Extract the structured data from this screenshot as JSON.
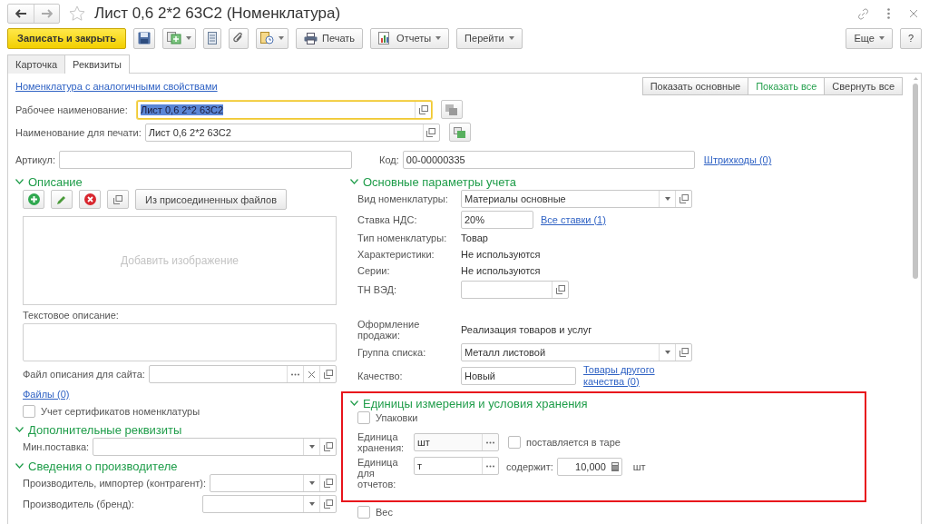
{
  "window": {
    "title": "Лист 0,6 2*2 63С2 (Номенклатура)",
    "favorite": false
  },
  "toolbar": {
    "items": [
      {
        "kind": "primary",
        "label": "Записать и закрыть"
      },
      {
        "kind": "icon"
      },
      {
        "kind": "icon-menu"
      },
      {
        "kind": "icon"
      },
      {
        "kind": "icon"
      },
      {
        "kind": "icon-menu"
      },
      {
        "kind": "text",
        "label": "Печать"
      },
      {
        "kind": "text-menu",
        "label": "Отчеты"
      },
      {
        "kind": "text-menu",
        "label": "Перейти"
      }
    ],
    "right": [
      {
        "kind": "text-menu",
        "label": "Еще"
      },
      {
        "kind": "text",
        "label": "?"
      }
    ]
  },
  "tabs": [
    {
      "label": "Карточка",
      "selected": false
    },
    {
      "label": "Реквизиты",
      "selected": true
    }
  ],
  "similar_link": "Номенклатура с аналогичными свойствами",
  "view_buttons": [
    {
      "label": "Показать основные",
      "selected": false
    },
    {
      "label": "Показать все",
      "selected": true
    },
    {
      "label": "Свернуть все",
      "selected": false
    }
  ],
  "names": [
    {
      "label": "Рабочее наименование:",
      "value": "Лист 0,6 2*2 63С2",
      "focused": true
    },
    {
      "label": "Наименование для печати:",
      "value": "Лист 0,6 2*2 63С2",
      "focused": false
    }
  ],
  "article": {
    "label": "Артикул:"
  },
  "code": {
    "label": "Код:",
    "value": "00-00000335"
  },
  "barcodes_link": "Штрихкоды (0)",
  "description": {
    "title": "Описание",
    "expanded": true,
    "attach_button": "Из присоединенных файлов",
    "image_placeholder": "Добавить изображение",
    "text_label": "Текстовое описание:",
    "site_file_label": "Файл описания для сайта:",
    "files_link": "Файлы (0)",
    "certificates": {
      "label": "Учет сертификатов номенклатуры",
      "checked": false
    }
  },
  "extra": {
    "title": "Дополнительные реквизиты",
    "expanded": true,
    "min_supply_label": "Мин.поставка:"
  },
  "manufacturer": {
    "title": "Сведения о производителе",
    "expanded": true,
    "fields": [
      {
        "label": "Производитель, импортер (контрагент):"
      },
      {
        "label": "Производитель (бренд):"
      }
    ]
  },
  "accounting": {
    "title": "Основные параметры учета",
    "expanded": true,
    "rows": [
      {
        "kind": "select",
        "label": "Вид номенклатуры:",
        "value": "Материалы основные"
      },
      {
        "kind": "input-link",
        "label": "Ставка НДС:",
        "value": "20%",
        "link": "Все ставки (1)"
      },
      {
        "kind": "text",
        "label": "Тип номенклатуры:",
        "value": "Товар"
      },
      {
        "kind": "text",
        "label": "Характеристики:",
        "value": "Не используются"
      },
      {
        "kind": "text",
        "label": "Серии:",
        "value": "Не используются"
      },
      {
        "kind": "open-field",
        "label": "ТН ВЭД:"
      },
      {
        "kind": "text",
        "label": "Оформление продажи:",
        "value": "Реализация товаров и услуг"
      },
      {
        "kind": "select",
        "label": "Группа списка:",
        "value": "Металл листовой"
      },
      {
        "kind": "input-link",
        "label": "Качество:",
        "value": "Новый",
        "link": "Товары другого качества (0)"
      }
    ]
  },
  "units": {
    "title": "Единицы измерения и условия хранения",
    "expanded": true,
    "highlighted": true,
    "packages": {
      "label": "Упаковки",
      "checked": false
    },
    "storage": {
      "label": "Единица хранения:",
      "value": "шт",
      "disabled": true,
      "in_container": {
        "label": "поставляется в таре",
        "checked": false
      }
    },
    "report": {
      "label": "Единица для отчетов:",
      "value": "т",
      "disabled": false,
      "contains_label": "содержит:",
      "contains_value": "10,000",
      "contains_unit": "шт"
    }
  },
  "weight": {
    "label": "Вес",
    "checked": false
  }
}
